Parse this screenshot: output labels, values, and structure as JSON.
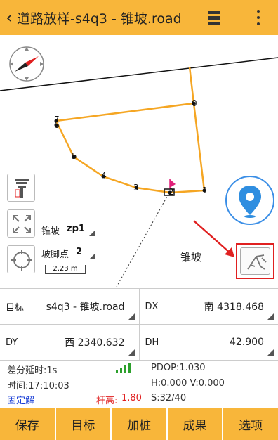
{
  "header": {
    "title": "道路放样-s4q3 - 锥坡.road",
    "back_icon": "chevron-left-icon",
    "menu_icon": "menu-icon",
    "more_icon": "more-vertical-icon"
  },
  "map": {
    "points": [
      {
        "label": "0"
      },
      {
        "label": "1"
      },
      {
        "label": "2"
      },
      {
        "label": "3"
      },
      {
        "label": "4"
      },
      {
        "label": "5"
      },
      {
        "label": "6"
      },
      {
        "label": "7"
      }
    ],
    "scale_label": "2.23 m",
    "slope_label": "锥坡",
    "mode_label": "锥坡",
    "mode_value": "zp1",
    "toe_label": "坡脚点",
    "toe_value": "2"
  },
  "info": {
    "target_label": "目标",
    "target_value": "s4q3 - 锥坡.road",
    "dx_label": "DX",
    "dx_value": "南 4318.468",
    "dy_label": "DY",
    "dy_value": "西 2340.632",
    "dh_label": "DH",
    "dh_value": "42.900"
  },
  "status": {
    "diff_delay": "差分延时:1s",
    "time": "时间:17:10:03",
    "solution": "固定解",
    "pole_label": "杆高:",
    "pole_value": "1.80",
    "pdop": "PDOP:1.030",
    "hv": "H:0.000  V:0.000",
    "sats": "S:32/40"
  },
  "colors": {
    "accent": "#f8b63a",
    "line": "#f5a623",
    "solution": "#1a3fd6",
    "pole": "#e02020",
    "signal": "#2ca02c",
    "highlight": "#e02020"
  },
  "bottom": [
    "保存",
    "目标",
    "加桩",
    "成果",
    "选项"
  ]
}
